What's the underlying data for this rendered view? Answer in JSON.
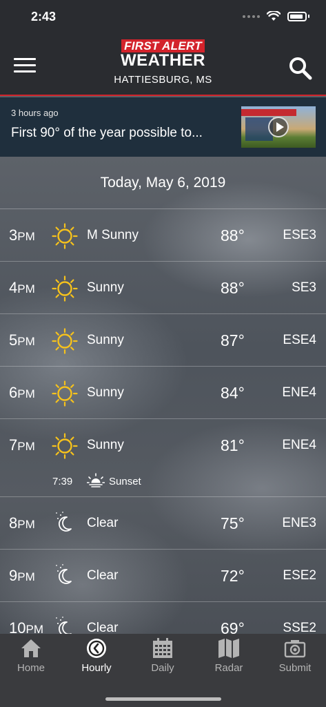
{
  "status_bar": {
    "time": "2:43"
  },
  "header": {
    "logo_line1": "FIRST ALERT",
    "logo_line2": "WEATHER",
    "location": "HATTIESBURG, MS"
  },
  "news": {
    "time_ago": "3 hours ago",
    "title": "First 90° of the year possible to..."
  },
  "date_label": "Today, May 6, 2019",
  "hours": [
    {
      "hour": "3",
      "suffix": "PM",
      "icon": "sun-icon",
      "condition": "M Sunny",
      "temp": "88°",
      "wind": "ESE3"
    },
    {
      "hour": "4",
      "suffix": "PM",
      "icon": "sun-icon",
      "condition": "Sunny",
      "temp": "88°",
      "wind": "SE3"
    },
    {
      "hour": "5",
      "suffix": "PM",
      "icon": "sun-icon",
      "condition": "Sunny",
      "temp": "87°",
      "wind": "ESE4"
    },
    {
      "hour": "6",
      "suffix": "PM",
      "icon": "sun-icon",
      "condition": "Sunny",
      "temp": "84°",
      "wind": "ENE4"
    },
    {
      "hour": "7",
      "suffix": "PM",
      "icon": "sun-icon",
      "condition": "Sunny",
      "temp": "81°",
      "wind": "ENE4"
    },
    {
      "hour": "8",
      "suffix": "PM",
      "icon": "moon-icon",
      "condition": "Clear",
      "temp": "75°",
      "wind": "ENE3"
    },
    {
      "hour": "9",
      "suffix": "PM",
      "icon": "moon-icon",
      "condition": "Clear",
      "temp": "72°",
      "wind": "ESE2"
    },
    {
      "hour": "10",
      "suffix": "PM",
      "icon": "moon-icon",
      "condition": "Clear",
      "temp": "69°",
      "wind": "SSE2"
    }
  ],
  "sunset": {
    "time": "7:39",
    "label": "Sunset"
  },
  "tabs": [
    {
      "label": "Home",
      "icon": "home-icon",
      "active": false
    },
    {
      "label": "Hourly",
      "icon": "clock-icon",
      "active": true
    },
    {
      "label": "Daily",
      "icon": "calendar-icon",
      "active": false
    },
    {
      "label": "Radar",
      "icon": "map-icon",
      "active": false
    },
    {
      "label": "Submit",
      "icon": "camera-icon",
      "active": false
    }
  ],
  "colors": {
    "brand_red": "#d3232b",
    "header_bg": "#2a2c30",
    "news_bg": "#1f2f3d",
    "sun_yellow": "#f6c21c",
    "tabbar_bg": "#3a3b3e"
  }
}
